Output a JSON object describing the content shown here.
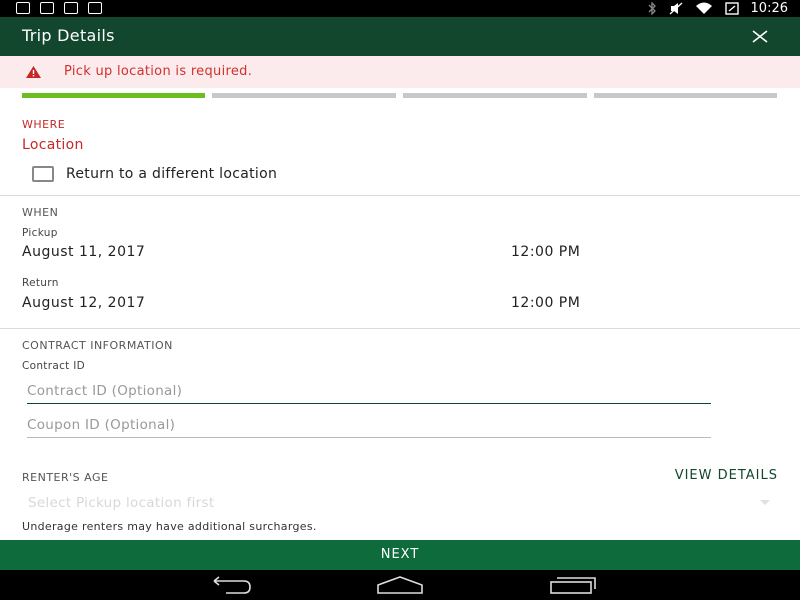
{
  "status_bar": {
    "time": "10:26"
  },
  "app_bar": {
    "title": "Trip Details",
    "close_icon": "close-icon"
  },
  "error": {
    "message": "Pick up location is required.",
    "icon": "warning-icon"
  },
  "progress": {
    "steps_total": 4,
    "steps_completed": 1,
    "active_color": "#6abf1e"
  },
  "where": {
    "section": "WHERE",
    "location_label": "Location",
    "different_return_label": "Return to a different location",
    "different_return_checked": false
  },
  "when": {
    "section": "WHEN",
    "pickup_label": "Pickup",
    "pickup_date": "August 11, 2017",
    "pickup_time": "12:00 PM",
    "return_label": "Return",
    "return_date": "August 12, 2017",
    "return_time": "12:00 PM"
  },
  "contract": {
    "section": "CONTRACT INFORMATION",
    "contract_id_label": "Contract ID",
    "contract_placeholder": "Contract ID (Optional)",
    "coupon_placeholder": "Coupon ID (Optional)"
  },
  "renter_age": {
    "section": "RENTER'S AGE",
    "view_details": "VIEW DETAILS",
    "select_placeholder": "Select Pickup location first",
    "note": "Underage renters may have additional surcharges."
  },
  "footer": {
    "next_label": "NEXT"
  },
  "colors": {
    "brand_dark": "#12472e",
    "button": "#0e6b3c",
    "error": "#c62828"
  }
}
